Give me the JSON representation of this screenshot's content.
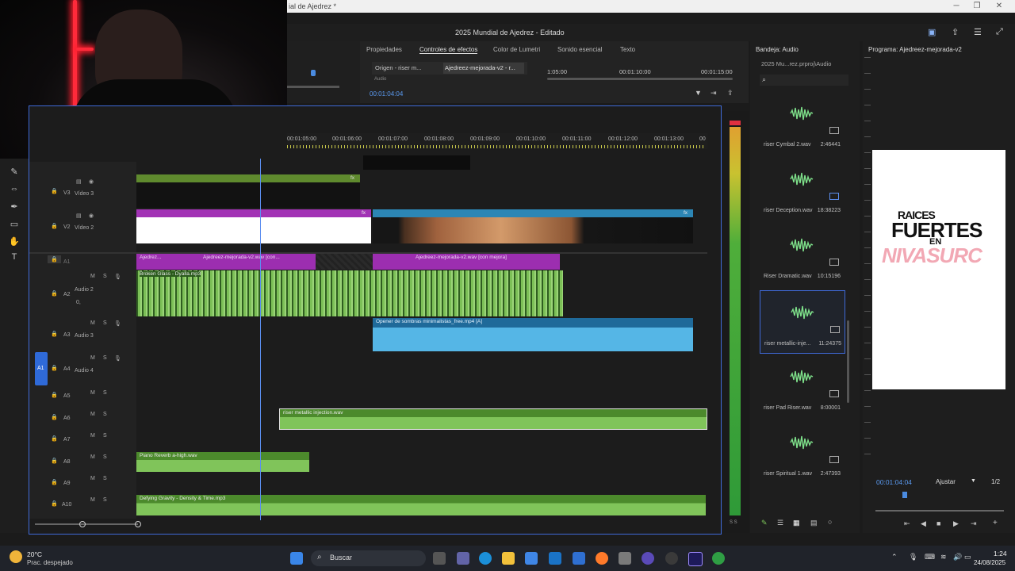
{
  "window": {
    "title": "ial de Ajedrez *",
    "project_title": "2025 Mundial de Ajedrez - Editado"
  },
  "effects_panel": {
    "tabs": [
      "Propiedades",
      "Controles de efectos",
      "Color de Lumetri",
      "Sonido esencial",
      "Texto"
    ],
    "source_tab": "Origen - riser m...",
    "sequence_tab": "Ajedreez-mejorada-v2 - r...",
    "timecode": "00:01:04:04",
    "ruler": [
      "1:05:00",
      "00:01:10:00",
      "00:01:15:00"
    ],
    "sub_label": "Audio"
  },
  "timeline": {
    "ruler": [
      "00:01:05:00",
      "00:01:06:00",
      "00:01:07:00",
      "00:01:08:00",
      "00:01:09:00",
      "00:01:10:00",
      "00:01:11:00",
      "00:01:12:00",
      "00:01:13:00",
      "00"
    ],
    "tracks": {
      "v3": {
        "id": "V3",
        "name": "Vídeo 3"
      },
      "v2": {
        "id": "V2",
        "name": "Vídeo 2"
      },
      "v1": {
        "id": "V1"
      },
      "a1": {
        "id": "A1"
      },
      "a2": {
        "id": "A2",
        "name": "Audio 2",
        "vol": "0,"
      },
      "a3": {
        "id": "A3",
        "name": "Audio 3"
      },
      "a4": {
        "id": "A4",
        "name": "Audio 4",
        "source": "A1"
      },
      "a5": {
        "id": "A5"
      },
      "a6": {
        "id": "A6"
      },
      "a7": {
        "id": "A7"
      },
      "a8": {
        "id": "A8"
      },
      "a9": {
        "id": "A9"
      },
      "a10": {
        "id": "A10"
      }
    },
    "track_buttons": {
      "m": "M",
      "s": "S"
    },
    "clips": {
      "a1_a": "Ajedrez...",
      "a1_b": "Ajedreez-mejorada-v2.wav [con...",
      "a1_c": "Ajedreez-mejorada-v2.wav [con mejora]",
      "a2": "Broken Glass - Dyalla.mp3",
      "a3": "Opener de sombras minimalistas_free.mp4 [A]",
      "a6": "riser metallic injection.wav",
      "a8": "Piano Reverb a-high.wav",
      "a10": "Defying Gravity - Density & Time.mp3",
      "fx": "fx"
    }
  },
  "audio_bin": {
    "title": "Bandeja: Audio",
    "path": "2025 Mu...rez.prproj\\Audio",
    "items": [
      {
        "name": "riser Cymbal 2.wav",
        "duration": "2:46441"
      },
      {
        "name": "riser Deception.wav",
        "duration": "18:38223"
      },
      {
        "name": "Riser Dramatic.wav",
        "duration": "10:15196"
      },
      {
        "name": "riser metallic-inje...",
        "duration": "11:24375"
      },
      {
        "name": "riser Pad Riser.wav",
        "duration": "8:00001"
      },
      {
        "name": "riser Spiritual 1.wav",
        "duration": "2:47393"
      }
    ]
  },
  "program": {
    "title": "Programa: Ajedreez-mejorada-v2",
    "timecode": "00:01:04:04",
    "fit": "Ajustar",
    "res": "1/2",
    "overlay": {
      "line1": "RAICES",
      "line2": "FUERTES",
      "line3": "EN",
      "line4": "NIVASURC"
    }
  },
  "meter_db": "S S",
  "taskbar": {
    "weather_temp": "20°C",
    "weather_desc": "Prac. despejado",
    "search": "Buscar",
    "time": "1:24",
    "date": "24/08/2025"
  }
}
